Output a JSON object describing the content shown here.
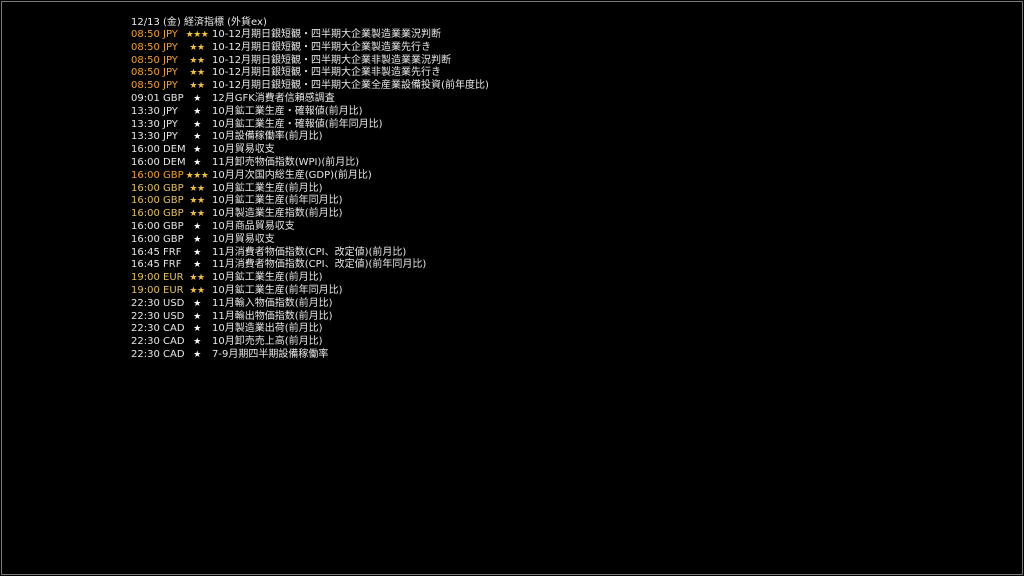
{
  "header": {
    "title": "12/13 (金) 経済指標 (外貨ex)"
  },
  "rows": [
    {
      "time": "08:50",
      "ccy": "JPY",
      "stars": "★★★",
      "name": "10-12月期日銀短観・四半期大企業製造業業況判断",
      "level": "hi"
    },
    {
      "time": "08:50",
      "ccy": "JPY",
      "stars": "★★",
      "name": "10-12月期日銀短観・四半期大企業製造業先行き",
      "level": "hi"
    },
    {
      "time": "08:50",
      "ccy": "JPY",
      "stars": "★★",
      "name": "10-12月期日銀短観・四半期大企業非製造業業況判断",
      "level": "hi"
    },
    {
      "time": "08:50",
      "ccy": "JPY",
      "stars": "★★",
      "name": "10-12月期日銀短観・四半期大企業非製造業先行き",
      "level": "hi"
    },
    {
      "time": "08:50",
      "ccy": "JPY",
      "stars": "★★",
      "name": "10-12月期日銀短観・四半期大企業全産業設備投資(前年度比)",
      "level": "hi"
    },
    {
      "time": "09:01",
      "ccy": "GBP",
      "stars": "★",
      "name": "12月GFK消費者信頼感調査",
      "level": "lo"
    },
    {
      "time": "13:30",
      "ccy": "JPY",
      "stars": "★",
      "name": "10月鉱工業生産・確報値(前月比)",
      "level": "lo"
    },
    {
      "time": "13:30",
      "ccy": "JPY",
      "stars": "★",
      "name": "10月鉱工業生産・確報値(前年同月比)",
      "level": "lo"
    },
    {
      "time": "13:30",
      "ccy": "JPY",
      "stars": "★",
      "name": "10月設備稼働率(前月比)",
      "level": "lo"
    },
    {
      "time": "16:00",
      "ccy": "DEM",
      "stars": "★",
      "name": "10月貿易収支",
      "level": "lo"
    },
    {
      "time": "16:00",
      "ccy": "DEM",
      "stars": "★",
      "name": "11月卸売物価指数(WPI)(前月比)",
      "level": "lo"
    },
    {
      "time": "16:00",
      "ccy": "GBP",
      "stars": "★★★",
      "name": "10月月次国内総生産(GDP)(前月比)",
      "level": "hi"
    },
    {
      "time": "16:00",
      "ccy": "GBP",
      "stars": "★★",
      "name": "10月鉱工業生産(前月比)",
      "level": "mid"
    },
    {
      "time": "16:00",
      "ccy": "GBP",
      "stars": "★★",
      "name": "10月鉱工業生産(前年同月比)",
      "level": "mid"
    },
    {
      "time": "16:00",
      "ccy": "GBP",
      "stars": "★★",
      "name": "10月製造業生産指数(前月比)",
      "level": "mid"
    },
    {
      "time": "16:00",
      "ccy": "GBP",
      "stars": "★",
      "name": "10月商品貿易収支",
      "level": "lo"
    },
    {
      "time": "16:00",
      "ccy": "GBP",
      "stars": "★",
      "name": "10月貿易収支",
      "level": "lo"
    },
    {
      "time": "16:45",
      "ccy": "FRF",
      "stars": "★",
      "name": "11月消費者物価指数(CPI、改定値)(前月比)",
      "level": "lo"
    },
    {
      "time": "16:45",
      "ccy": "FRF",
      "stars": "★",
      "name": "11月消費者物価指数(CPI、改定値)(前年同月比)",
      "level": "lo"
    },
    {
      "time": "19:00",
      "ccy": "EUR",
      "stars": "★★",
      "name": "10月鉱工業生産(前月比)",
      "level": "mid"
    },
    {
      "time": "19:00",
      "ccy": "EUR",
      "stars": "★★",
      "name": "10月鉱工業生産(前年同月比)",
      "level": "mid"
    },
    {
      "time": "22:30",
      "ccy": "USD",
      "stars": "★",
      "name": "11月輸入物価指数(前月比)",
      "level": "lo"
    },
    {
      "time": "22:30",
      "ccy": "USD",
      "stars": "★",
      "name": "11月輸出物価指数(前月比)",
      "level": "lo"
    },
    {
      "time": "22:30",
      "ccy": "CAD",
      "stars": "★",
      "name": "10月製造業出荷(前月比)",
      "level": "lo"
    },
    {
      "time": "22:30",
      "ccy": "CAD",
      "stars": "★",
      "name": "10月卸売売上高(前月比)",
      "level": "lo"
    },
    {
      "time": "22:30",
      "ccy": "CAD",
      "stars": "★",
      "name": "7-9月期四半期設備稼働率",
      "level": "lo"
    }
  ],
  "colors": {
    "background": "#000000",
    "high_importance": "#f0a030",
    "medium_importance": "#e0c060",
    "normal_text": "#e6e6e6",
    "star_gold": "#f0c040"
  }
}
